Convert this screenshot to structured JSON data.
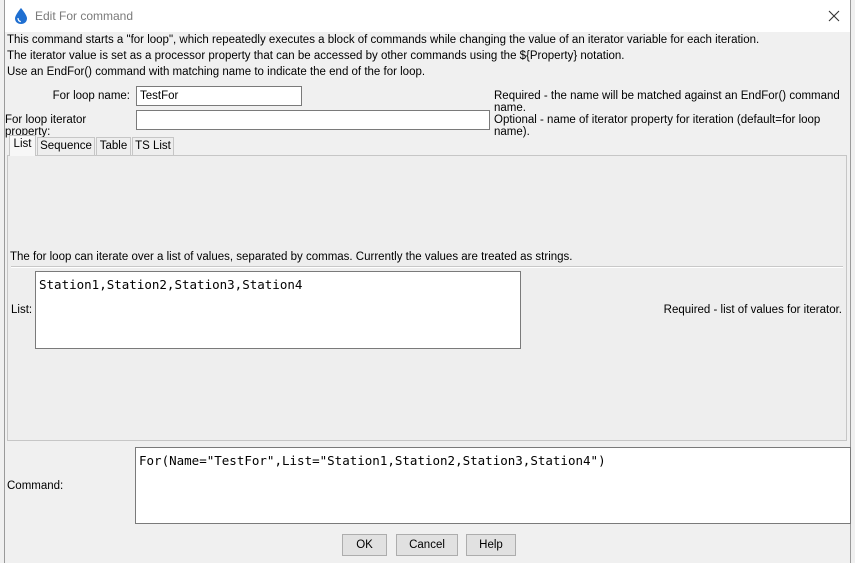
{
  "window": {
    "title": "Edit For command",
    "close_icon": "close-icon",
    "app_icon": "water-drop-icon"
  },
  "description": {
    "line1": "This command starts a \"for loop\", which repeatedly executes a block of commands while changing the value of an iterator variable for each iteration.",
    "line2": "The iterator value is set as a processor property that can be accessed by other commands using the ${Property} notation.",
    "line3": "Use an EndFor() command with matching name to indicate the end of the for loop."
  },
  "fields": {
    "loop_name": {
      "label": "For loop name:",
      "value": "TestFor",
      "note": "Required - the name will be matched against an EndFor() command name."
    },
    "iterator_property": {
      "label": "For loop iterator property:",
      "value": "",
      "note": "Optional - name of iterator property for iteration (default=for loop name)."
    }
  },
  "tabs": [
    {
      "label": "List",
      "active": true
    },
    {
      "label": "Sequence",
      "active": false
    },
    {
      "label": "Table",
      "active": false
    },
    {
      "label": "TS List",
      "active": false
    }
  ],
  "list_tab": {
    "info": "The for loop can iterate over a list of values, separated by commas.  Currently the values are treated as strings.",
    "list_label": "List:",
    "list_value": "Station1,Station2,Station3,Station4",
    "list_note": "Required - list of values for iterator."
  },
  "command": {
    "label": "Command:",
    "value": "For(Name=\"TestFor\",List=\"Station1,Station2,Station3,Station4\")"
  },
  "buttons": {
    "ok": "OK",
    "cancel": "Cancel",
    "help": "Help"
  },
  "colors": {
    "dialog_bg": "#f0f0f0",
    "title_text": "#7a7a7a",
    "icon_blue": "#1f6fd1"
  }
}
